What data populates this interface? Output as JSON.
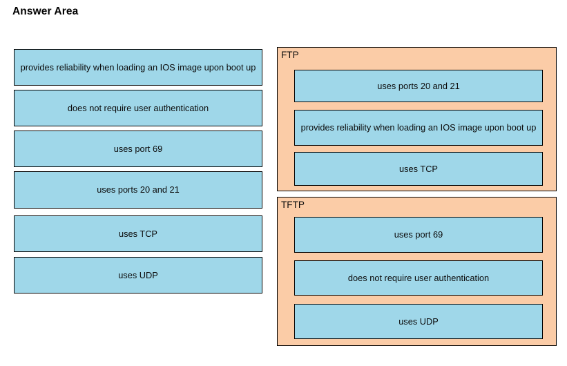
{
  "page": {
    "title": "Answer Area",
    "background_color": "#FFFFFF",
    "tile_fill_color": "#9FD7E9",
    "tile_border_color": "#000000",
    "panel_fill_color": "#FBCCA7",
    "panel_border_color": "#000000",
    "text_color": "#0B0B0B"
  },
  "source_column": {
    "name": "draggable-options",
    "tiles": [
      {
        "label": "provides reliability when loading an IOS image upon boot up"
      },
      {
        "label": "does not require user authentication"
      },
      {
        "label": "uses port 69"
      },
      {
        "label": "uses ports 20 and 21"
      },
      {
        "label": "uses TCP"
      },
      {
        "label": "uses UDP"
      }
    ]
  },
  "drop_panels": [
    {
      "label": "FTP",
      "tiles": [
        {
          "label": "uses ports 20 and 21"
        },
        {
          "label": "provides reliability when loading an IOS image upon boot up"
        },
        {
          "label": "uses TCP"
        }
      ]
    },
    {
      "label": "TFTP",
      "tiles": [
        {
          "label": "uses port 69"
        },
        {
          "label": "does not require user authentication"
        },
        {
          "label": "uses UDP"
        }
      ]
    }
  ]
}
